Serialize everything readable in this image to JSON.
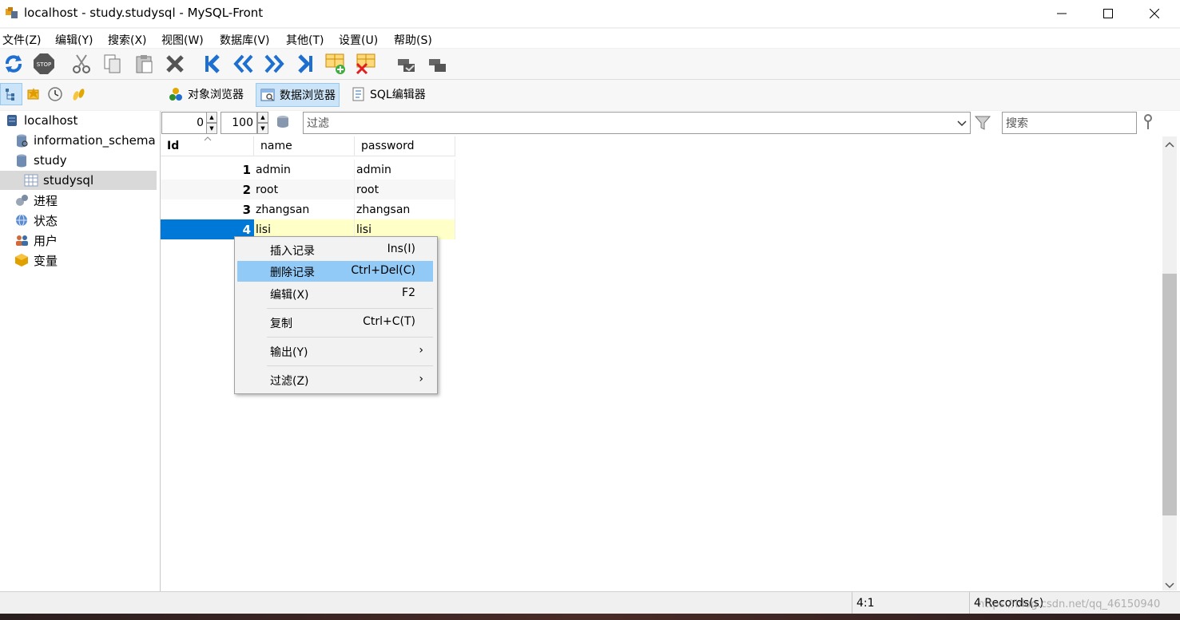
{
  "window": {
    "title": "localhost - study.studysql - MySQL-Front",
    "controls": [
      "minimize",
      "maximize",
      "close"
    ]
  },
  "menubar": [
    "文件(Z)",
    "编辑(Y)",
    "搜索(X)",
    "视图(W)",
    "数据库(V)",
    "其他(T)",
    "设置(U)",
    "帮助(S)"
  ],
  "toolbar": {
    "icons": [
      "refresh-icon",
      "stop-icon",
      "cut-icon",
      "copy-icon",
      "paste-icon",
      "delete-icon",
      "first-record-icon",
      "prev-page-icon",
      "next-page-icon",
      "last-record-icon",
      "insert-row-icon",
      "delete-row-icon",
      "commit-icon",
      "rollback-icon"
    ]
  },
  "toolbar2": {
    "left_icons": [
      "tree-view-icon",
      "favorites-icon",
      "history-icon",
      "bookmarks-icon"
    ],
    "tabs": [
      {
        "label": "对象浏览器",
        "active": false
      },
      {
        "label": "数据浏览器",
        "active": true
      },
      {
        "label": "SQL编辑器",
        "active": false
      }
    ]
  },
  "tree": [
    {
      "label": "localhost",
      "icon": "server-icon",
      "level": 0
    },
    {
      "label": "information_schema",
      "icon": "database-icon",
      "level": 1
    },
    {
      "label": "study",
      "icon": "database-icon",
      "level": 1
    },
    {
      "label": "studysql",
      "icon": "table-icon",
      "level": 2,
      "selected": true
    },
    {
      "label": "进程",
      "icon": "process-icon",
      "level": 1
    },
    {
      "label": "状态",
      "icon": "status-icon",
      "level": 1
    },
    {
      "label": "用户",
      "icon": "users-icon",
      "level": 1
    },
    {
      "label": "变量",
      "icon": "variables-icon",
      "level": 1
    }
  ],
  "databar": {
    "offset": "0",
    "limit": "100",
    "filter_placeholder": "过滤",
    "search_placeholder": "搜索"
  },
  "grid": {
    "columns": [
      "Id",
      "name",
      "password"
    ],
    "rows": [
      {
        "id": "1",
        "name": "admin",
        "password": "admin"
      },
      {
        "id": "2",
        "name": "root",
        "password": "root"
      },
      {
        "id": "3",
        "name": "zhangsan",
        "password": "zhangsan"
      },
      {
        "id": "4",
        "name": "lisi",
        "password": "lisi"
      }
    ]
  },
  "context_menu": [
    {
      "label": "插入记录",
      "shortcut": "Ins(I)"
    },
    {
      "label": "删除记录",
      "shortcut": "Ctrl+Del(C)",
      "highlighted": true
    },
    {
      "label": "编辑(X)",
      "shortcut": "F2"
    },
    {
      "label": "复制",
      "shortcut": "Ctrl+C(T)"
    },
    {
      "label": "输出(Y)",
      "shortcut": "›"
    },
    {
      "label": "过滤(Z)",
      "shortcut": "›"
    }
  ],
  "status": {
    "position": "4:1",
    "records": "4 Records(s)",
    "watermark": "https://blog.csdn.net/qq_46150940"
  },
  "colors": {
    "selection": "#0078d7",
    "row_alt": "#f7f7f7",
    "edit_row": "#ffffc8",
    "menu_highlight": "#91c9f7"
  }
}
